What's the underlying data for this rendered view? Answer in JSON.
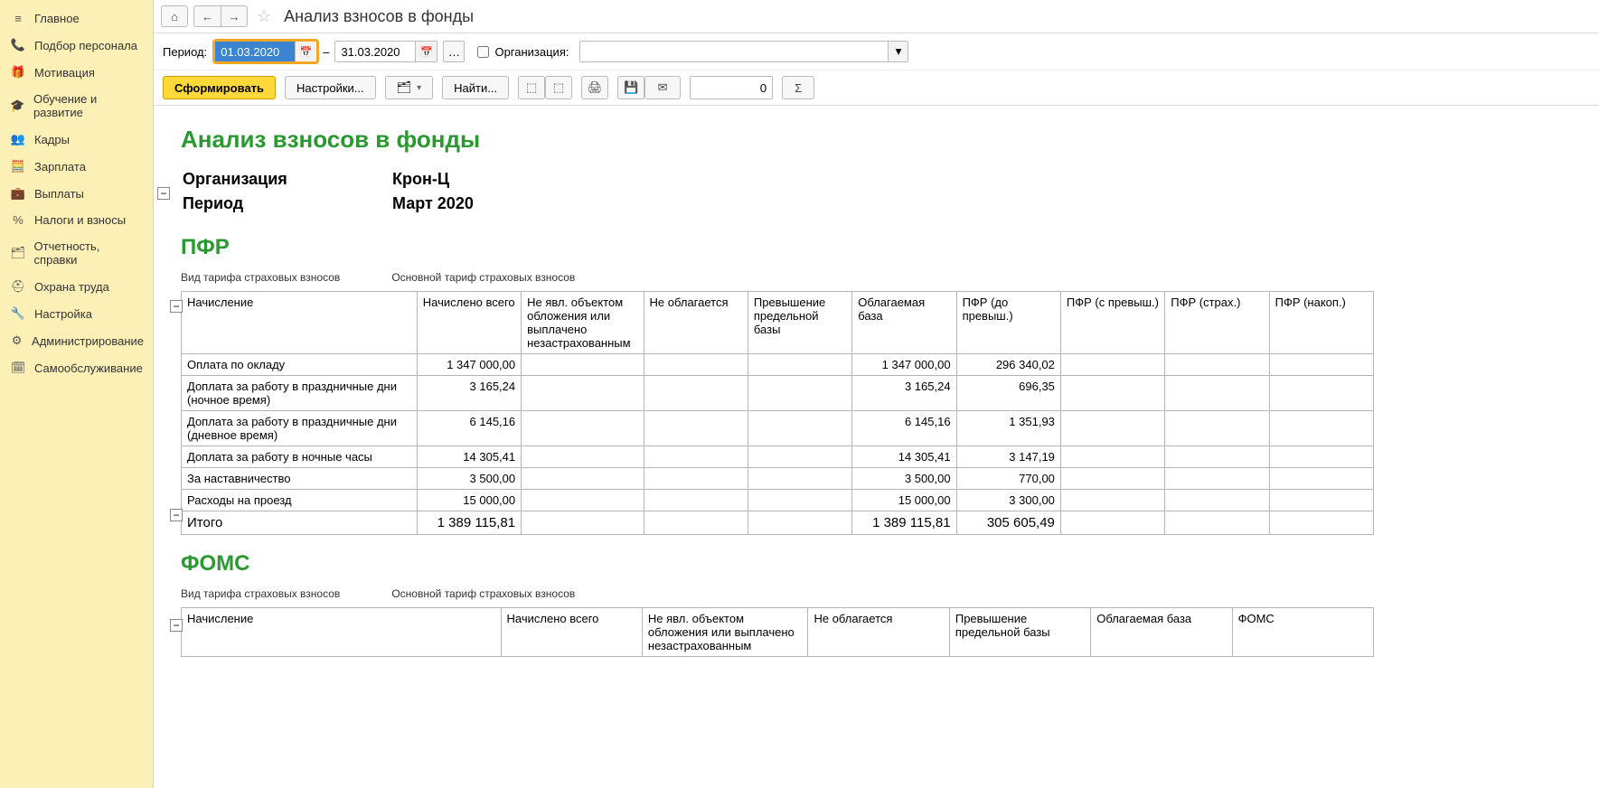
{
  "page_title": "Анализ взносов в фонды",
  "sidebar": {
    "items": [
      {
        "icon": "≡",
        "label": "Главное"
      },
      {
        "icon": "📞",
        "label": "Подбор персонала"
      },
      {
        "icon": "🎁",
        "label": "Мотивация"
      },
      {
        "icon": "🎓",
        "label": "Обучение и развитие"
      },
      {
        "icon": "👥",
        "label": "Кадры"
      },
      {
        "icon": "🧮",
        "label": "Зарплата"
      },
      {
        "icon": "💼",
        "label": "Выплаты"
      },
      {
        "icon": "%",
        "label": "Налоги и взносы"
      },
      {
        "icon": "🗂",
        "label": "Отчетность, справки"
      },
      {
        "icon": "⛑",
        "label": "Охрана труда"
      },
      {
        "icon": "🔧",
        "label": "Настройка"
      },
      {
        "icon": "⚙",
        "label": "Администрирование"
      },
      {
        "icon": "🗓",
        "label": "Самообслуживание"
      }
    ]
  },
  "filter": {
    "period_label": "Период:",
    "date_from": "01.03.2020",
    "date_to": "31.03.2020",
    "dash": "–",
    "org_label": "Организация:",
    "org_value": ""
  },
  "toolbar": {
    "generate": "Сформировать",
    "settings": "Настройки...",
    "find": "Найти...",
    "num_value": "0"
  },
  "report": {
    "title": "Анализ взносов в фонды",
    "meta_org_label": "Организация",
    "meta_org_value": "Крон-Ц",
    "meta_period_label": "Период",
    "meta_period_value": "Март 2020",
    "tariff_label": "Вид тарифа страховых взносов",
    "tariff_value": "Основной тариф страховых взносов",
    "cols_pfr": [
      "Начисление",
      "Начислено всего",
      "Не явл. объектом обложения или выплачено незастрахованным",
      "Не облагается",
      "Превышение предельной базы",
      "Облагаемая база",
      "ПФР (до превыш.)",
      "ПФР (с превыш.)",
      "ПФР (страх.)",
      "ПФР (накоп.)"
    ],
    "cols_foms": [
      "Начисление",
      "Начислено всего",
      "Не явл. объектом обложения или выплачено незастрахованным",
      "Не облагается",
      "Превышение предельной базы",
      "Облагаемая база",
      "ФОМС"
    ],
    "section_pfr": "ПФР",
    "section_foms": "ФОМС",
    "rows_pfr": [
      {
        "name": "Оплата по окладу",
        "total": "1 347 000,00",
        "base": "1 347 000,00",
        "pfr": "296 340,02"
      },
      {
        "name": "Доплата за работу в праздничные дни (ночное время)",
        "total": "3 165,24",
        "base": "3 165,24",
        "pfr": "696,35"
      },
      {
        "name": "Доплата за работу в праздничные дни (дневное время)",
        "total": "6 145,16",
        "base": "6 145,16",
        "pfr": "1 351,93"
      },
      {
        "name": "Доплата за работу в ночные часы",
        "total": "14 305,41",
        "base": "14 305,41",
        "pfr": "3 147,19"
      },
      {
        "name": "За наставничество",
        "total": "3 500,00",
        "base": "3 500,00",
        "pfr": "770,00"
      },
      {
        "name": "Расходы на проезд",
        "total": "15 000,00",
        "base": "15 000,00",
        "pfr": "3 300,00"
      }
    ],
    "total_pfr": {
      "name": "Итого",
      "total": "1 389 115,81",
      "base": "1 389 115,81",
      "pfr": "305 605,49"
    }
  }
}
